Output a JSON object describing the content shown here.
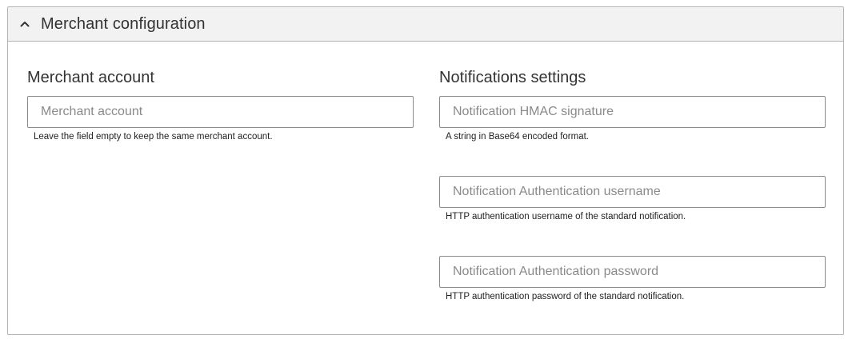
{
  "panel": {
    "title": "Merchant configuration",
    "toggle_icon": "chevron-up-icon"
  },
  "merchant_section": {
    "title": "Merchant account",
    "fields": [
      {
        "placeholder": "Merchant account",
        "value": "",
        "hint": "Leave the field empty to keep the same merchant account."
      }
    ]
  },
  "notifications_section": {
    "title": "Notifications settings",
    "fields": [
      {
        "placeholder": "Notification HMAC signature",
        "value": "",
        "hint": "A string in Base64 encoded format."
      },
      {
        "placeholder": "Notification Authentication username",
        "value": "",
        "hint": "HTTP authentication username of the standard notification."
      },
      {
        "placeholder": "Notification Authentication password",
        "value": "",
        "hint": "HTTP authentication password of the standard notification."
      }
    ]
  }
}
